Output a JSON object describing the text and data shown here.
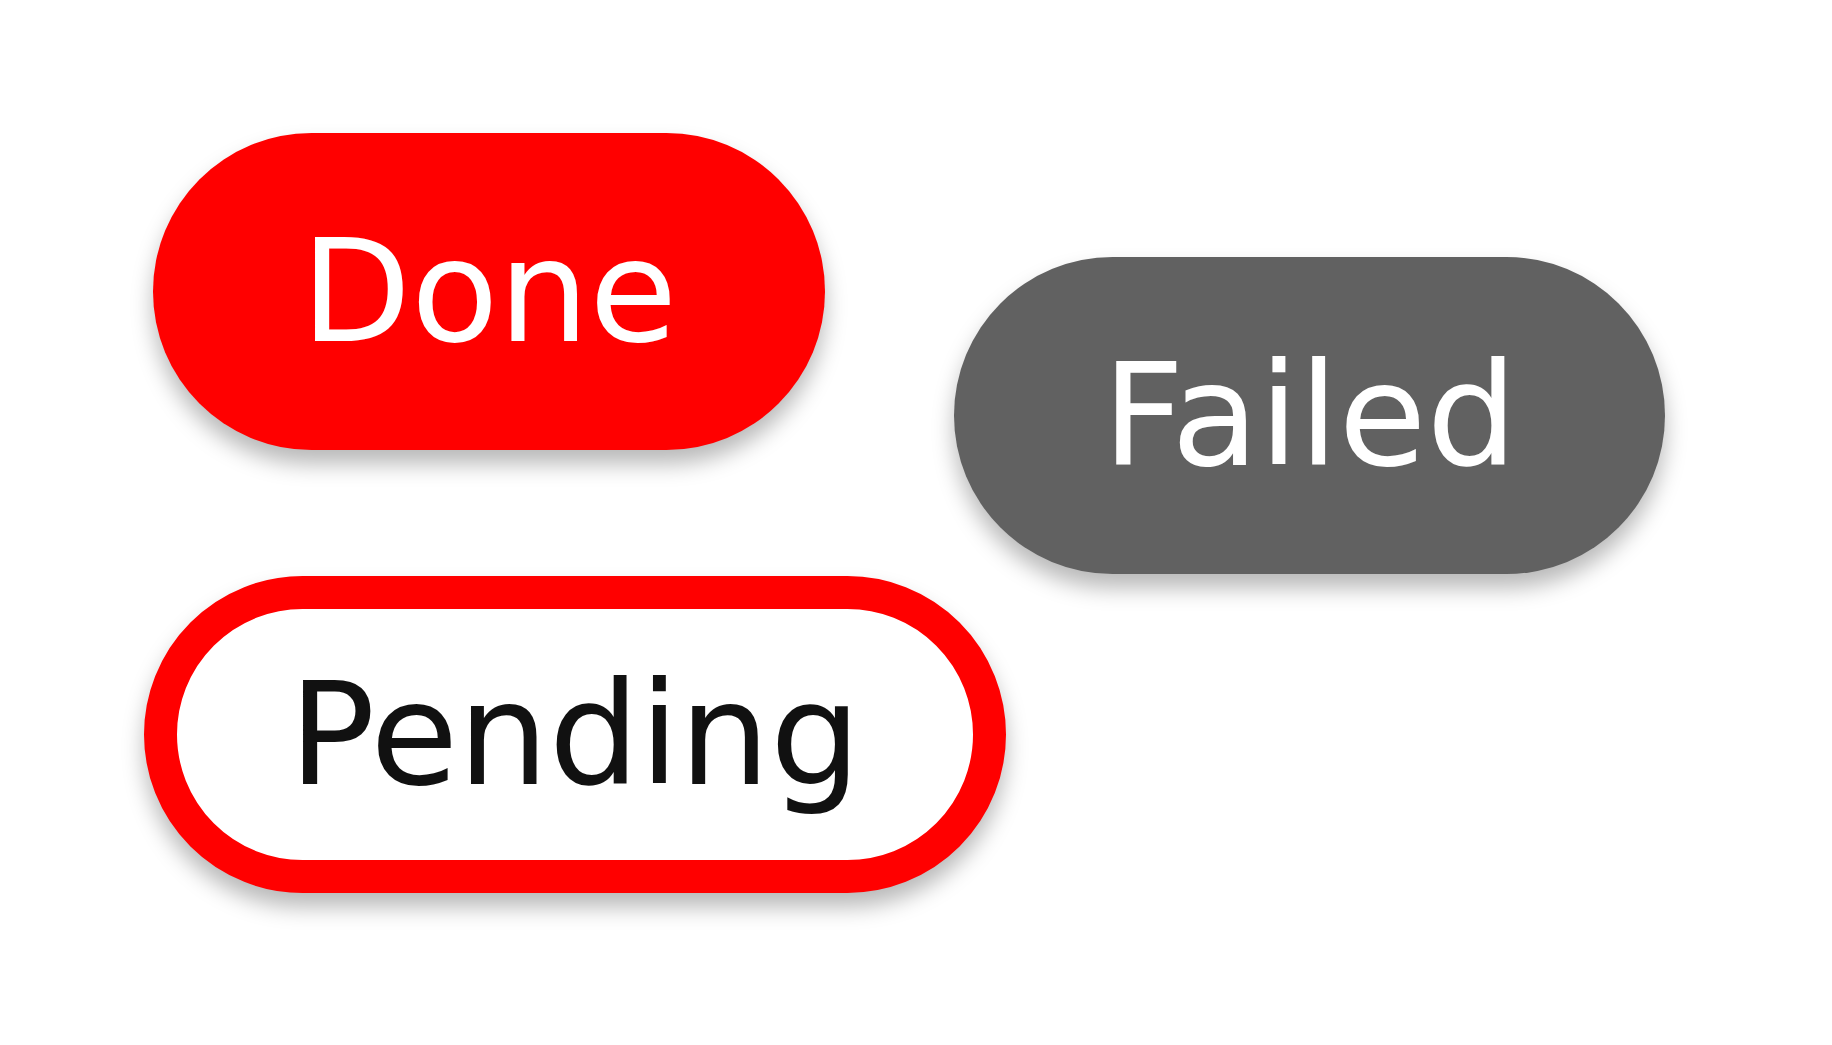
{
  "badges": [
    {
      "label": "Done",
      "kind": "filled",
      "color": "#ff0000"
    },
    {
      "label": "Failed",
      "kind": "filled",
      "color": "#616161"
    },
    {
      "label": "Pending",
      "kind": "outlined",
      "color": "#ff0000"
    }
  ]
}
